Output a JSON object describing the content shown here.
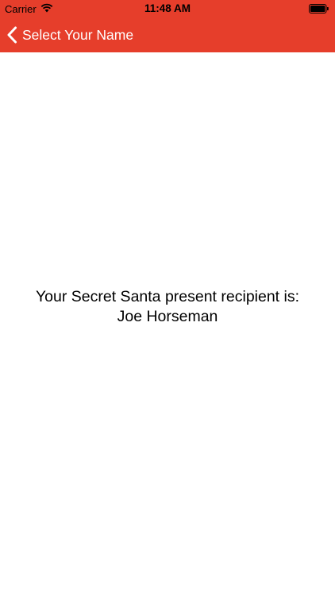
{
  "status_bar": {
    "carrier": "Carrier",
    "time": "11:48 AM",
    "wifi_icon": "wifi-icon",
    "battery_icon": "battery-icon",
    "battery_level": 1.0
  },
  "nav_bar": {
    "back_label": "Select Your Name",
    "back_icon": "chevron-left-icon",
    "color": "#e63e2b"
  },
  "main": {
    "message_line1": "Your Secret Santa present recipient is:",
    "recipient_name": "Joe Horseman"
  }
}
